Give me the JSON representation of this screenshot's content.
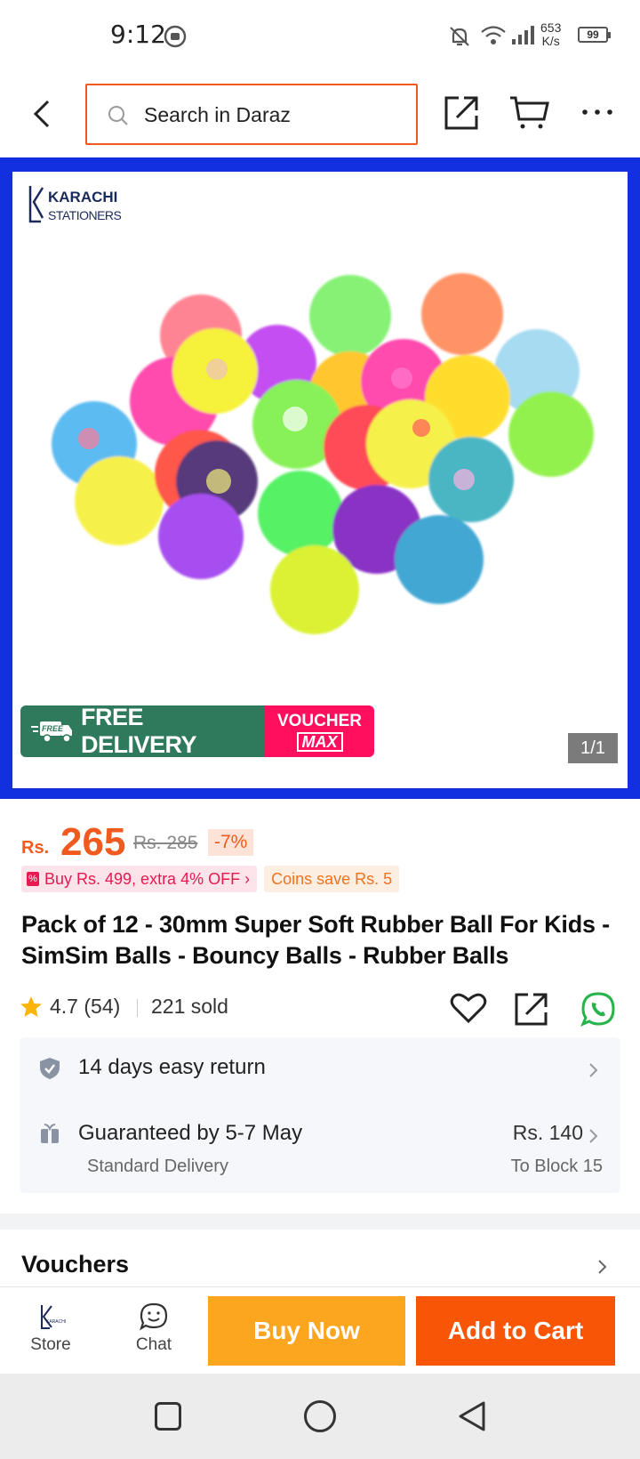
{
  "status_bar": {
    "time": "9:12",
    "net_speed_value": "653",
    "net_speed_unit": "K/s",
    "battery": "99"
  },
  "header": {
    "search_placeholder": "Search in Daraz",
    "icons": [
      "back-arrow-icon",
      "search-icon",
      "share-icon",
      "cart-icon",
      "more-icon"
    ]
  },
  "gallery": {
    "store_logo_line1": "KARACHI",
    "store_logo_line2": "STATIONERS",
    "promo_free_badge": "FREE",
    "promo_text": "FREE DELIVERY",
    "promo_voucher_line1": "VOUCHER",
    "promo_voucher_line2": "MAX",
    "page_counter": "1/1"
  },
  "product": {
    "currency": "Rs.",
    "price": "265",
    "old_price": "Rs. 285",
    "discount": "-7%",
    "promo_tag": "Buy Rs. 499, extra 4% OFF ›",
    "coins_tag": "Coins save Rs. 5",
    "title": "Pack of 12 - 30mm Super Soft Rubber Ball For Kids - SimSim Balls - Bouncy Balls - Rubber Balls",
    "rating": "4.7 (54)",
    "sold": "221 sold"
  },
  "services": {
    "return_text": "14 days easy return",
    "delivery_text": "Guaranteed by 5-7 May",
    "delivery_type": "Standard Delivery",
    "delivery_fee": "Rs. 140",
    "delivery_to": "To Block 15"
  },
  "vouchers": {
    "label": "Vouchers"
  },
  "action_bar": {
    "store_label": "Store",
    "chat_label": "Chat",
    "buy_now": "Buy Now",
    "add_to_cart": "Add to Cart"
  },
  "colors": {
    "brand_orange": "#f85606",
    "buy_now": "#fca61f",
    "price": "#f05a1f",
    "gallery_border": "#1230e0",
    "promo_green": "#2f7a5d",
    "promo_pink": "#ff0f5e"
  }
}
